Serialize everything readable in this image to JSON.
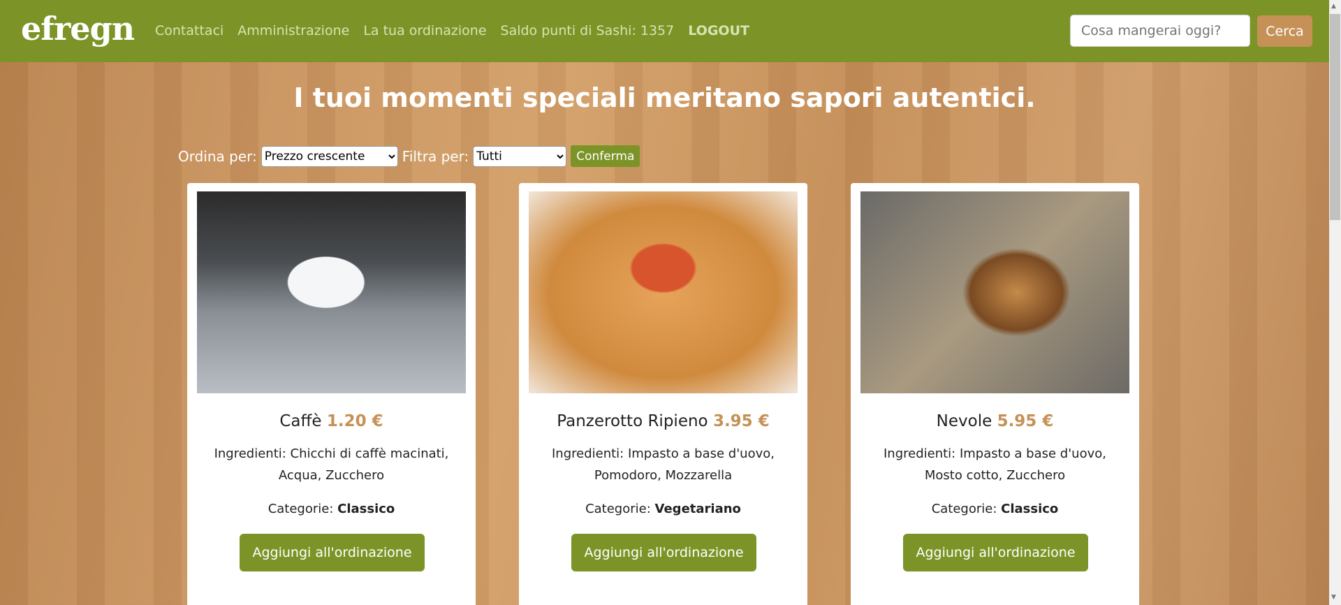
{
  "nav": {
    "logo": "efregn",
    "links": [
      "Contattaci",
      "Amministrazione",
      "La tua ordinazione",
      "Saldo punti di Sashi: 1357"
    ],
    "logout": "LOGOUT",
    "search_placeholder": "Cosa mangerai oggi?",
    "search_button": "Cerca"
  },
  "hero": {
    "title": "I tuoi momenti speciali meritano sapori autentici."
  },
  "controls": {
    "sort_label": "Ordina per:",
    "sort_value": "Prezzo crescente",
    "filter_label": "Filtra per:",
    "filter_value": "Tutti",
    "confirm": "Conferma"
  },
  "products": [
    {
      "name": "Caffè",
      "price": "1.20 €",
      "ingredients": "Ingredienti: Chicchi di caffè macinati, Acqua, Zucchero",
      "category_label": "Categorie:",
      "category": "Classico",
      "button": "Aggiungi all'ordinazione"
    },
    {
      "name": "Panzerotto Ripieno",
      "price": "3.95 €",
      "ingredients": "Ingredienti: Impasto a base d'uovo, Pomodoro, Mozzarella",
      "category_label": "Categorie:",
      "category": "Vegetariano",
      "button": "Aggiungi all'ordinazione"
    },
    {
      "name": "Nevole",
      "price": "5.95 €",
      "ingredients": "Ingredienti: Impasto a base d'uovo, Mosto cotto, Zucchero",
      "category_label": "Categorie:",
      "category": "Classico",
      "button": "Aggiungi all'ordinazione"
    }
  ],
  "colors": {
    "brand": "#7c9427",
    "accent": "#c69157"
  }
}
